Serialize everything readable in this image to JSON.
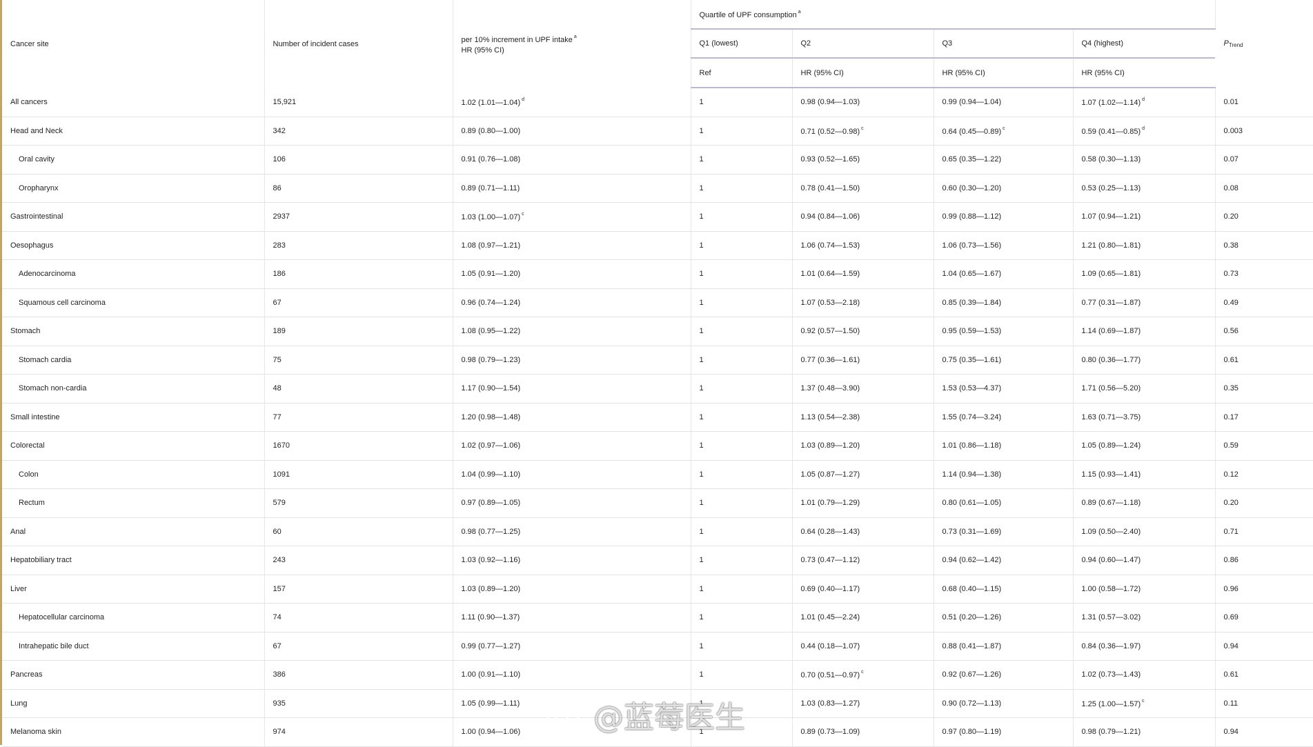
{
  "table": {
    "header": {
      "cancer_site": "Cancer site",
      "cases": "Number of incident cases",
      "per10_line1": "per 10% increment in UPF intake",
      "per10_sup": "a",
      "per10_line2": "HR (95% CI)",
      "quartile_group": "Quartile of UPF consumption",
      "quartile_group_sup": "a",
      "q1": "Q1 (lowest)",
      "q2": "Q2",
      "q3": "Q3",
      "q4": "Q4 (highest)",
      "ptrend_p": "P",
      "ptrend_sub": "Trend",
      "q1_sub": "Ref",
      "q2_sub": "HR (95% CI)",
      "q3_sub": "HR (95% CI)",
      "q4_sub": "HR (95% CI)"
    },
    "rows": [
      {
        "site": "All cancers",
        "indent": false,
        "cases": "15,921",
        "per10": "1.02 (1.01—1.04)",
        "per10_sup": "d",
        "q1": "1",
        "q2": "0.98 (0.94—1.03)",
        "q2_sup": "",
        "q3": "0.99 (0.94—1.04)",
        "q3_sup": "",
        "q4": "1.07 (1.02—1.14)",
        "q4_sup": "d",
        "ptrend": "0.01"
      },
      {
        "site": "Head and Neck",
        "indent": false,
        "cases": "342",
        "per10": "0.89 (0.80—1.00)",
        "per10_sup": "",
        "q1": "1",
        "q2": "0.71 (0.52—0.98)",
        "q2_sup": "c",
        "q3": "0.64 (0.45—0.89)",
        "q3_sup": "c",
        "q4": "0.59 (0.41—0.85)",
        "q4_sup": "d",
        "ptrend": "0.003"
      },
      {
        "site": "Oral cavity",
        "indent": true,
        "cases": "106",
        "per10": "0.91 (0.76—1.08)",
        "per10_sup": "",
        "q1": "1",
        "q2": "0.93 (0.52—1.65)",
        "q2_sup": "",
        "q3": "0.65 (0.35—1.22)",
        "q3_sup": "",
        "q4": "0.58 (0.30—1.13)",
        "q4_sup": "",
        "ptrend": "0.07"
      },
      {
        "site": "Oropharynx",
        "indent": true,
        "cases": "86",
        "per10": "0.89 (0.71—1.11)",
        "per10_sup": "",
        "q1": "1",
        "q2": "0.78 (0.41—1.50)",
        "q2_sup": "",
        "q3": "0.60 (0.30—1.20)",
        "q3_sup": "",
        "q4": "0.53 (0.25—1.13)",
        "q4_sup": "",
        "ptrend": "0.08"
      },
      {
        "site": "Gastrointestinal",
        "indent": false,
        "cases": "2937",
        "per10": "1.03 (1.00—1.07)",
        "per10_sup": "c",
        "q1": "1",
        "q2": "0.94 (0.84—1.06)",
        "q2_sup": "",
        "q3": "0.99 (0.88—1.12)",
        "q3_sup": "",
        "q4": "1.07 (0.94—1.21)",
        "q4_sup": "",
        "ptrend": "0.20"
      },
      {
        "site": "Oesophagus",
        "indent": false,
        "cases": "283",
        "per10": "1.08 (0.97—1.21)",
        "per10_sup": "",
        "q1": "1",
        "q2": "1.06 (0.74—1.53)",
        "q2_sup": "",
        "q3": "1.06 (0.73—1.56)",
        "q3_sup": "",
        "q4": "1.21 (0.80—1.81)",
        "q4_sup": "",
        "ptrend": "0.38"
      },
      {
        "site": "Adenocarcinoma",
        "indent": true,
        "cases": "186",
        "per10": "1.05 (0.91—1.20)",
        "per10_sup": "",
        "q1": "1",
        "q2": "1.01 (0.64—1.59)",
        "q2_sup": "",
        "q3": "1.04 (0.65—1.67)",
        "q3_sup": "",
        "q4": "1.09 (0.65—1.81)",
        "q4_sup": "",
        "ptrend": "0.73"
      },
      {
        "site": "Squamous cell carcinoma",
        "indent": true,
        "cases": "67",
        "per10": "0.96 (0.74—1.24)",
        "per10_sup": "",
        "q1": "1",
        "q2": "1.07 (0.53—2.18)",
        "q2_sup": "",
        "q3": "0.85 (0.39—1.84)",
        "q3_sup": "",
        "q4": "0.77 (0.31—1.87)",
        "q4_sup": "",
        "ptrend": "0.49"
      },
      {
        "site": "Stomach",
        "indent": false,
        "cases": "189",
        "per10": "1.08 (0.95—1.22)",
        "per10_sup": "",
        "q1": "1",
        "q2": "0.92 (0.57—1.50)",
        "q2_sup": "",
        "q3": "0.95 (0.59—1.53)",
        "q3_sup": "",
        "q4": "1.14 (0.69—1.87)",
        "q4_sup": "",
        "ptrend": "0.56"
      },
      {
        "site": "Stomach cardia",
        "indent": true,
        "cases": "75",
        "per10": "0.98 (0.79—1.23)",
        "per10_sup": "",
        "q1": "1",
        "q2": "0.77 (0.36—1.61)",
        "q2_sup": "",
        "q3": "0.75 (0.35—1.61)",
        "q3_sup": "",
        "q4": "0.80 (0.36—1.77)",
        "q4_sup": "",
        "ptrend": "0.61"
      },
      {
        "site": "Stomach non-cardia",
        "indent": true,
        "cases": "48",
        "per10": "1.17 (0.90—1.54)",
        "per10_sup": "",
        "q1": "1",
        "q2": "1.37 (0.48—3.90)",
        "q2_sup": "",
        "q3": "1.53 (0.53—4.37)",
        "q3_sup": "",
        "q4": "1.71 (0.56—5.20)",
        "q4_sup": "",
        "ptrend": "0.35"
      },
      {
        "site": "Small intestine",
        "indent": false,
        "cases": "77",
        "per10": "1.20 (0.98—1.48)",
        "per10_sup": "",
        "q1": "1",
        "q2": "1.13 (0.54—2.38)",
        "q2_sup": "",
        "q3": "1.55 (0.74—3.24)",
        "q3_sup": "",
        "q4": "1.63 (0.71—3.75)",
        "q4_sup": "",
        "ptrend": "0.17"
      },
      {
        "site": "Colorectal",
        "indent": false,
        "cases": "1670",
        "per10": "1.02 (0.97—1.06)",
        "per10_sup": "",
        "q1": "1",
        "q2": "1.03 (0.89—1.20)",
        "q2_sup": "",
        "q3": "1.01 (0.86—1.18)",
        "q3_sup": "",
        "q4": "1.05 (0.89—1.24)",
        "q4_sup": "",
        "ptrend": "0.59"
      },
      {
        "site": "Colon",
        "indent": true,
        "cases": "1091",
        "per10": "1.04 (0.99—1.10)",
        "per10_sup": "",
        "q1": "1",
        "q2": "1.05 (0.87—1.27)",
        "q2_sup": "",
        "q3": "1.14 (0.94—1.38)",
        "q3_sup": "",
        "q4": "1.15 (0.93—1.41)",
        "q4_sup": "",
        "ptrend": "0.12"
      },
      {
        "site": "Rectum",
        "indent": true,
        "cases": "579",
        "per10": "0.97 (0.89—1.05)",
        "per10_sup": "",
        "q1": "1",
        "q2": "1.01 (0.79—1.29)",
        "q2_sup": "",
        "q3": "0.80 (0.61—1.05)",
        "q3_sup": "",
        "q4": "0.89 (0.67—1.18)",
        "q4_sup": "",
        "ptrend": "0.20"
      },
      {
        "site": "Anal",
        "indent": false,
        "cases": "60",
        "per10": "0.98 (0.77—1.25)",
        "per10_sup": "",
        "q1": "1",
        "q2": "0.64 (0.28—1.43)",
        "q2_sup": "",
        "q3": "0.73 (0.31—1.69)",
        "q3_sup": "",
        "q4": "1.09 (0.50—2.40)",
        "q4_sup": "",
        "ptrend": "0.71"
      },
      {
        "site": "Hepatobiliary tract",
        "indent": false,
        "cases": "243",
        "per10": "1.03 (0.92—1.16)",
        "per10_sup": "",
        "q1": "1",
        "q2": "0.73 (0.47—1.12)",
        "q2_sup": "",
        "q3": "0.94 (0.62—1.42)",
        "q3_sup": "",
        "q4": "0.94 (0.60—1.47)",
        "q4_sup": "",
        "ptrend": "0.86"
      },
      {
        "site": "Liver",
        "indent": false,
        "cases": "157",
        "per10": "1.03 (0.89—1.20)",
        "per10_sup": "",
        "q1": "1",
        "q2": "0.69 (0.40—1.17)",
        "q2_sup": "",
        "q3": "0.68 (0.40—1.15)",
        "q3_sup": "",
        "q4": "1.00 (0.58—1.72)",
        "q4_sup": "",
        "ptrend": "0.96"
      },
      {
        "site": "Hepatocellular carcinoma",
        "indent": true,
        "cases": "74",
        "per10": "1.11 (0.90—1.37)",
        "per10_sup": "",
        "q1": "1",
        "q2": "1.01 (0.45—2.24)",
        "q2_sup": "",
        "q3": "0.51 (0.20—1.26)",
        "q3_sup": "",
        "q4": "1.31 (0.57—3.02)",
        "q4_sup": "",
        "ptrend": "0.69"
      },
      {
        "site": "Intrahepatic bile duct",
        "indent": true,
        "cases": "67",
        "per10": "0.99 (0.77—1.27)",
        "per10_sup": "",
        "q1": "1",
        "q2": "0.44 (0.18—1.07)",
        "q2_sup": "",
        "q3": "0.88 (0.41—1.87)",
        "q3_sup": "",
        "q4": "0.84 (0.36—1.97)",
        "q4_sup": "",
        "ptrend": "0.94"
      },
      {
        "site": "Pancreas",
        "indent": false,
        "cases": "386",
        "per10": "1.00 (0.91—1.10)",
        "per10_sup": "",
        "q1": "1",
        "q2": "0.70 (0.51—0.97)",
        "q2_sup": "c",
        "q3": "0.92 (0.67—1.26)",
        "q3_sup": "",
        "q4": "1.02 (0.73—1.43)",
        "q4_sup": "",
        "ptrend": "0.61"
      },
      {
        "site": "Lung",
        "indent": false,
        "cases": "935",
        "per10": "1.05 (0.99—1.11)",
        "per10_sup": "",
        "q1": "1",
        "q2": "1.03 (0.83—1.27)",
        "q2_sup": "",
        "q3": "0.90 (0.72—1.13)",
        "q3_sup": "",
        "q4": "1.25 (1.00—1.57)",
        "q4_sup": "c",
        "ptrend": "0.11"
      },
      {
        "site": "Melanoma skin",
        "indent": false,
        "cases": "974",
        "per10": "1.00 (0.94—1.06)",
        "per10_sup": "",
        "q1": "1",
        "q2": "0.89 (0.73—1.09)",
        "q2_sup": "",
        "q3": "0.97 (0.80—1.19)",
        "q3_sup": "",
        "q4": "0.98 (0.79—1.21)",
        "q4_sup": "",
        "ptrend": "0.94"
      }
    ]
  },
  "watermark": {
    "text": "@蓝莓医生",
    "icon": "weibo-logo-icon"
  }
}
